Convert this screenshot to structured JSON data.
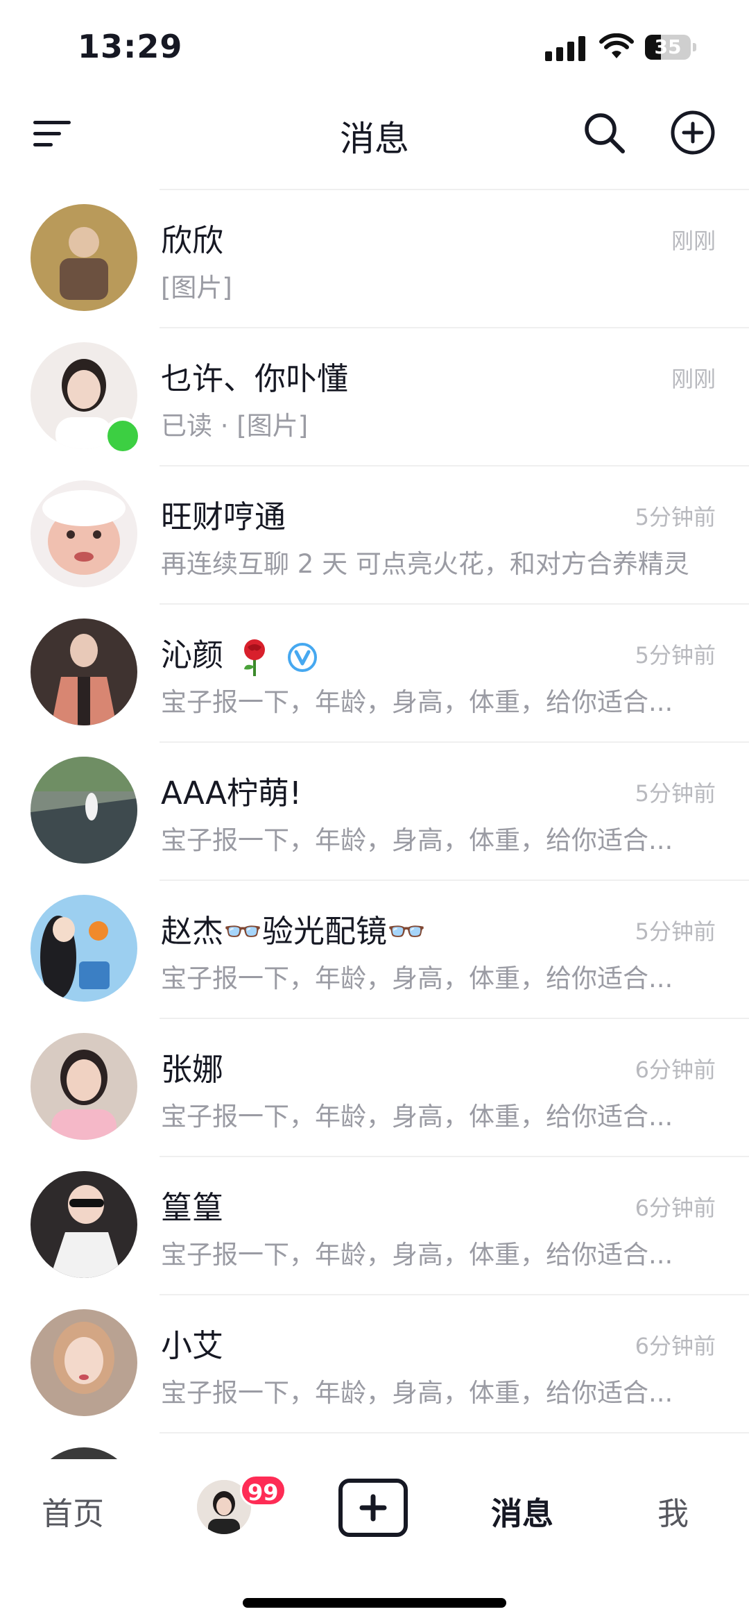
{
  "status_bar": {
    "time": "13:29",
    "battery": "35",
    "battery_level": 0.35
  },
  "header": {
    "title": "消息"
  },
  "conversations": [
    {
      "name": "欣欣",
      "time": "刚刚",
      "preview": "[图片]",
      "online": false,
      "avatar_color": "#8a6b3e"
    },
    {
      "name": "乜许、你卟懂",
      "time": "刚刚",
      "preview": "已读 · [图片]",
      "online": true,
      "avatar_color": "#e9e2dd"
    },
    {
      "name": "旺财哼通",
      "time": "5分钟前",
      "preview": "再连续互聊 2 天 可点亮火花，和对方合养精灵",
      "online": false,
      "avatar_color": "#e8b7a6"
    },
    {
      "name": "沁颜",
      "time": "5分钟前",
      "preview": "宝子报一下，年龄，身高，体重，给你适合...",
      "online": false,
      "avatar_color": "#6e4a3c",
      "emojis": [
        "rose-icon",
        "verified-icon"
      ]
    },
    {
      "name": "AAA柠萌!",
      "time": "5分钟前",
      "preview": "宝子报一下，年龄，身高，体重，给你适合...",
      "online": false,
      "avatar_color": "#5b6660"
    },
    {
      "name": "赵杰👓验光配镜👓",
      "time": "5分钟前",
      "preview": "宝子报一下，年龄，身高，体重，给你适合...",
      "online": false,
      "avatar_color": "#5aa9dc"
    },
    {
      "name": "张娜",
      "time": "6分钟前",
      "preview": "宝子报一下，年龄，身高，体重，给你适合...",
      "online": false,
      "avatar_color": "#c9b3a4"
    },
    {
      "name": "篁篁",
      "time": "6分钟前",
      "preview": "宝子报一下，年龄，身高，体重，给你适合...",
      "online": false,
      "avatar_color": "#3a3536"
    },
    {
      "name": "小艾",
      "time": "6分钟前",
      "preview": "宝子报一下，年龄，身高，体重，给你适合...",
      "online": false,
      "avatar_color": "#b88d70"
    }
  ],
  "bottom_nav": {
    "home": "首页",
    "badge": "99",
    "messages": "消息",
    "me": "我"
  },
  "colors": {
    "accent": "#fe2c55",
    "online": "#3ccf42",
    "text": "#161823",
    "muted": "#9a9ba3"
  }
}
